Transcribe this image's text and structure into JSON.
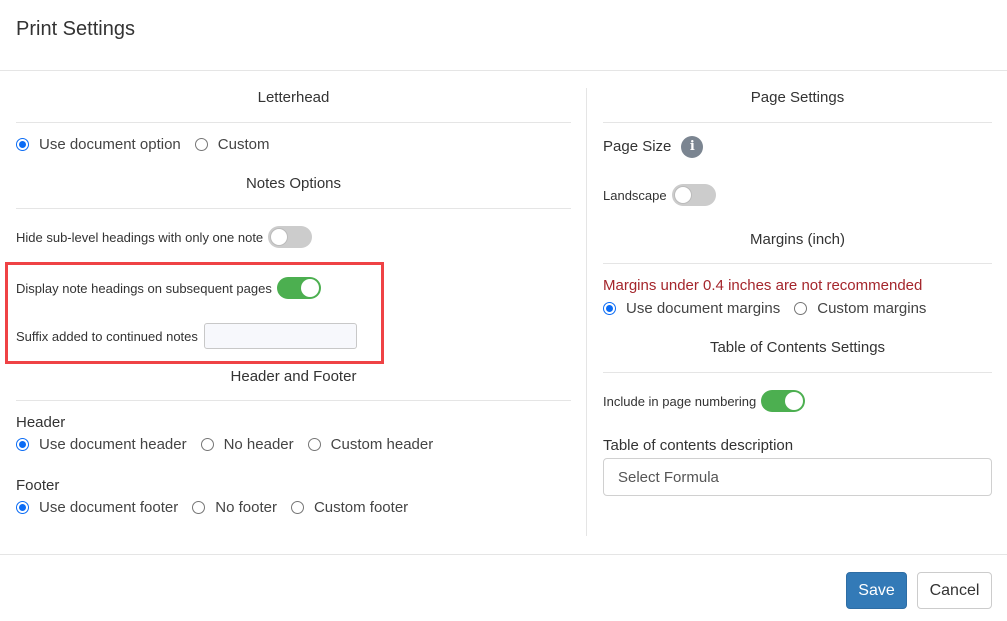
{
  "modal": {
    "title": "Print Settings"
  },
  "left": {
    "letterhead": {
      "title": "Letterhead",
      "options": [
        {
          "label": "Use document option",
          "checked": true
        },
        {
          "label": "Custom",
          "checked": false
        }
      ]
    },
    "notes_options": {
      "title": "Notes Options",
      "hide_sub_level": {
        "label": "Hide sub-level headings with only one note",
        "on": false
      },
      "display_note_headings": {
        "label": "Display note headings on subsequent pages",
        "on": true
      },
      "suffix": {
        "label": "Suffix added to continued notes",
        "value": ""
      }
    },
    "header_footer": {
      "title": "Header and Footer",
      "header": {
        "label": "Header",
        "options": [
          {
            "label": "Use document header",
            "checked": true
          },
          {
            "label": "No header",
            "checked": false
          },
          {
            "label": "Custom header",
            "checked": false
          }
        ]
      },
      "footer": {
        "label": "Footer",
        "options": [
          {
            "label": "Use document footer",
            "checked": true
          },
          {
            "label": "No footer",
            "checked": false
          },
          {
            "label": "Custom footer",
            "checked": false
          }
        ]
      }
    }
  },
  "right": {
    "page_settings": {
      "title": "Page Settings",
      "page_size_label": "Page Size",
      "info_icon": "i",
      "landscape": {
        "label": "Landscape",
        "on": false
      }
    },
    "margins": {
      "title": "Margins (inch)",
      "warning": "Margins under 0.4 inches are not recommended",
      "options": [
        {
          "label": "Use document margins",
          "checked": true
        },
        {
          "label": "Custom margins",
          "checked": false
        }
      ]
    },
    "toc": {
      "title": "Table of Contents Settings",
      "include_numbering": {
        "label": "Include in page numbering",
        "on": true
      },
      "description_label": "Table of contents description",
      "description_placeholder": "Select Formula"
    }
  },
  "footer_buttons": {
    "save": "Save",
    "cancel": "Cancel"
  },
  "colors": {
    "accent_radio": "#0b6cf5",
    "toggle_on": "#4caf50",
    "highlight": "#ef4245",
    "warning": "#a4262c",
    "primary_button": "#337ab7"
  }
}
